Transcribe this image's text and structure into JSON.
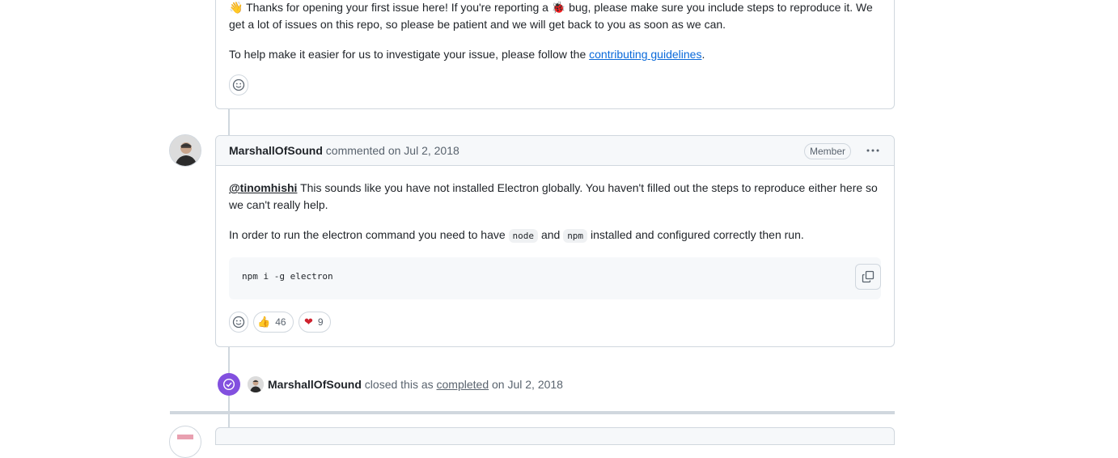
{
  "first_comment": {
    "line1_pre": "Thanks for opening your first issue here! If you're reporting a",
    "line1_post": "bug, please make sure you include steps to reproduce it. We",
    "line2": "get a lot of issues on this repo, so please be patient and we will get back to you as soon as we can.",
    "line3_pre": "To help make it easier for us to investigate your issue, please follow the",
    "line3_link": "contributing guidelines",
    "line3_post": "."
  },
  "comment": {
    "author": "MarshallOfSound",
    "meta": "commented on Jul 2, 2018",
    "role_badge": "Member",
    "mention": "@tinomhishi",
    "line1_rest": "This sounds like you have not installed Electron globally. You haven't filled out the steps to reproduce either here so",
    "line2": "we can't really help.",
    "line3_pre": "In order to run the electron command you need to have",
    "code1": "node",
    "line3_mid": "and",
    "code2": "npm",
    "line3_post": "installed and configured correctly then run.",
    "code_block": "npm i -g electron",
    "reactions": [
      {
        "emoji": "👍",
        "count": "46"
      },
      {
        "emoji": "❤",
        "count": "9"
      }
    ]
  },
  "event": {
    "actor": "MarshallOfSound",
    "text_pre": "closed this as",
    "state_link": "completed",
    "text_post": "on Jul 2, 2018"
  },
  "colors": {
    "accent_link": "#0969da",
    "closed_purple": "#8250df",
    "border": "#d0d7de"
  }
}
